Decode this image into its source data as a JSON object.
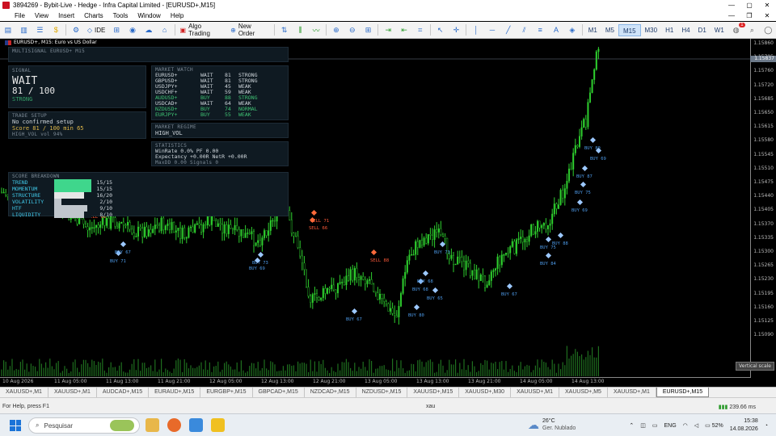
{
  "window": {
    "title": "3894269 - Bybit-Live - Hedge - Infra Capital Limited - [EURUSD+,M15]",
    "controls": [
      "—",
      "▢",
      "✕"
    ]
  },
  "menu": {
    "items": [
      "File",
      "View",
      "Insert",
      "Charts",
      "Tools",
      "Window",
      "Help"
    ],
    "doc_controls": [
      "—",
      "❐",
      "✕"
    ]
  },
  "toolbar": {
    "ide_label": "IDE",
    "algo_trading_label": "Algo Trading",
    "new_order_label": "New Order",
    "timeframes": [
      "M1",
      "M5",
      "M15",
      "M30",
      "H1",
      "H4",
      "D1",
      "W1"
    ],
    "active_timeframe": "M15",
    "notification_count": "1"
  },
  "chart": {
    "header": "EURUSD+, M15:  Euro vs US Dollar",
    "price_levels": [
      "1.15860",
      "1.15795",
      "1.15760",
      "1.15720",
      "1.15685",
      "1.15650",
      "1.15615",
      "1.15580",
      "1.15545",
      "1.15510",
      "1.15475",
      "1.15440",
      "1.15405",
      "1.15370",
      "1.15335",
      "1.15300",
      "1.15265",
      "1.15230",
      "1.15195",
      "1.15160",
      "1.15125",
      "1.15090"
    ],
    "current_price_tag": "1.15837",
    "vertical_scale_label": "Vertical scale",
    "time_labels": [
      "10 Aug 2026",
      "11 Aug 05:00",
      "11 Aug 13:00",
      "11 Aug 21:00",
      "12 Aug 05:00",
      "12 Aug 13:00",
      "12 Aug 21:00",
      "13 Aug 05:00",
      "13 Aug 13:00",
      "13 Aug 21:00",
      "14 Aug 05:00",
      "14 Aug 13:00"
    ],
    "signals": [
      {
        "text": "SELL 68",
        "kind": "sell"
      },
      {
        "text": "BUY 71",
        "kind": "buy"
      },
      {
        "text": "BUY 67",
        "kind": "buy"
      },
      {
        "text": "BUY 73",
        "kind": "buy"
      },
      {
        "text": "BUY 69",
        "kind": "buy"
      },
      {
        "text": "SELL 71",
        "kind": "sell"
      },
      {
        "text": "SELL 66",
        "kind": "sell"
      },
      {
        "text": "BUY 67",
        "kind": "buy"
      },
      {
        "text": "SELL 88",
        "kind": "sell"
      },
      {
        "text": "BUY 80",
        "kind": "buy"
      },
      {
        "text": "BUY 68",
        "kind": "buy"
      },
      {
        "text": "BUY 65",
        "kind": "buy"
      },
      {
        "text": "BUY 73",
        "kind": "buy"
      },
      {
        "text": "BUY 68",
        "kind": "buy"
      },
      {
        "text": "BUY 67",
        "kind": "buy"
      },
      {
        "text": "BUY 80",
        "kind": "buy"
      },
      {
        "text": "BUY 69",
        "kind": "buy"
      },
      {
        "text": "BUY 87",
        "kind": "buy"
      },
      {
        "text": "BUY 75",
        "kind": "buy"
      },
      {
        "text": "BUY 69",
        "kind": "buy"
      },
      {
        "text": "BUY 88",
        "kind": "buy"
      },
      {
        "text": "BUY 75",
        "kind": "buy"
      },
      {
        "text": "BUY 84",
        "kind": "buy"
      }
    ]
  },
  "dashboard": {
    "title": "MULTISIGNAL   EURUSD+ M15",
    "signal": {
      "header": "SIGNAL",
      "state": "WAIT",
      "score": "81 / 100",
      "strength": "STRONG"
    },
    "trade_setup": {
      "header": "TRADE SETUP",
      "line1": "No confirmed setup",
      "line2": "Score 81 / 100   min 65",
      "line3": "HIGH_VOL   vol 94%"
    },
    "market_watch": {
      "header": "MARKET WATCH",
      "rows": [
        {
          "symbol": "EURUSD+",
          "action": "WAIT",
          "score": "81",
          "strength": "STRONG",
          "color": "#cfd6dc"
        },
        {
          "symbol": "GBPUSD+",
          "action": "WAIT",
          "score": "81",
          "strength": "STRONG",
          "color": "#cfd6dc"
        },
        {
          "symbol": "USDJPY+",
          "action": "WAIT",
          "score": "45",
          "strength": "WEAK",
          "color": "#cfd6dc"
        },
        {
          "symbol": "USDCHF+",
          "action": "WAIT",
          "score": "59",
          "strength": "WEAK",
          "color": "#cfd6dc"
        },
        {
          "symbol": "AUDUSD+",
          "action": "BUY",
          "score": "88",
          "strength": "STRONG",
          "color": "#3fc274"
        },
        {
          "symbol": "USDCAD+",
          "action": "WAIT",
          "score": "64",
          "strength": "WEAK",
          "color": "#cfd6dc"
        },
        {
          "symbol": "NZDUSD+",
          "action": "BUY",
          "score": "74",
          "strength": "NORMAL",
          "color": "#3fc274"
        },
        {
          "symbol": "EURJPY+",
          "action": "BUY",
          "score": "55",
          "strength": "WEAK",
          "color": "#3fc274"
        }
      ]
    },
    "market_regime": {
      "header": "MARKET REGIME",
      "value": "HIGH_VOL"
    },
    "statistics": {
      "header": "STATISTICS",
      "line1": "WinRate 0.0%   PF 0.00",
      "line2": "Expectancy +0.00R   NetR +0.00R",
      "line3": "MaxDD 0.00   Signals 0"
    },
    "score_breakdown": {
      "header": "SCORE BREAKDOWN",
      "rows": [
        {
          "name": "TREND",
          "value": "15/15",
          "fill": 1.0,
          "color": "#3fd68c"
        },
        {
          "name": "MOMENTUM",
          "value": "15/15",
          "fill": 1.0,
          "color": "#3fd68c"
        },
        {
          "name": "STRUCTURE",
          "value": "16/20",
          "fill": 0.8,
          "color": "#e6e6e6"
        },
        {
          "name": "VOLATILITY",
          "value": "2/10",
          "fill": 0.2,
          "color": "#c0c6cc"
        },
        {
          "name": "HTF",
          "value": "9/10",
          "fill": 0.9,
          "color": "#c0c6cc"
        },
        {
          "name": "LIQUIDITY",
          "value": "8/10",
          "fill": 0.8,
          "color": "#c0c6cc"
        }
      ]
    }
  },
  "tabs": {
    "items": [
      "XAUUSD+,M1",
      "XAUUSD+,M1",
      "AUDCAD+,M15",
      "EURAUD+,M15",
      "EURGBP+,M15",
      "GBPCAD+,M15",
      "NZDCAD+,M15",
      "NZDUSD+,M15",
      "XAUUSD+,M15",
      "XAUUSD+,M30",
      "XAUUSD+,M1",
      "XAUUSD+,M5",
      "XAUUSD+,M1",
      "EURUSD+,M15"
    ],
    "active_index": 13
  },
  "status": {
    "help": "For Help, press F1",
    "search": "xau",
    "network": "239.66 ms"
  },
  "taskbar": {
    "search_placeholder": "Pesquisar",
    "weather_temp": "26°C",
    "weather_desc": "Ger. Nublado",
    "language": "ENG",
    "battery": "52%",
    "time": "15:38",
    "date": "14.08.2026"
  }
}
